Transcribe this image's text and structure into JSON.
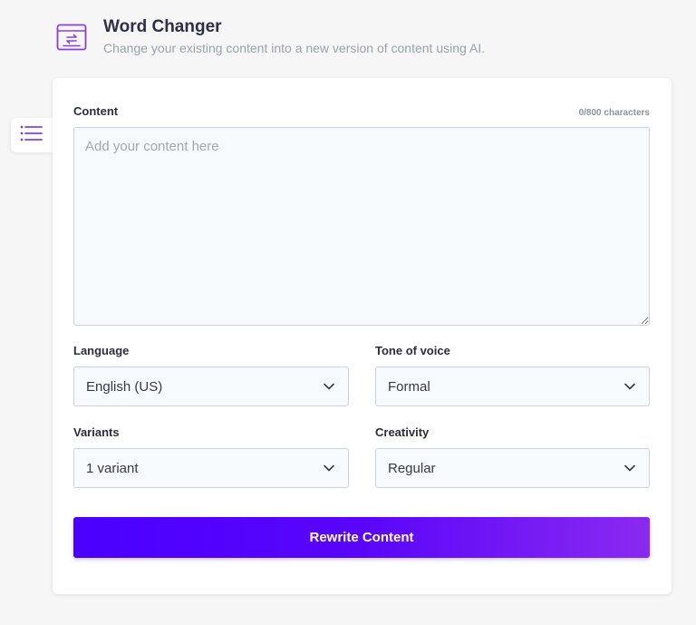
{
  "header": {
    "title": "Word Changer",
    "subtitle": "Change your existing content into a new version of content using AI.",
    "icon": "text-replace-icon"
  },
  "sidebar_toggle": {
    "icon": "list-icon"
  },
  "form": {
    "content": {
      "label": "Content",
      "counter": "0/800 characters",
      "placeholder": "Add your content here",
      "value": ""
    },
    "language": {
      "label": "Language",
      "value": "English (US)"
    },
    "tone": {
      "label": "Tone of voice",
      "value": "Formal"
    },
    "variants": {
      "label": "Variants",
      "value": "1 variant"
    },
    "creativity": {
      "label": "Creativity",
      "value": "Regular"
    },
    "submit_label": "Rewrite Content"
  },
  "colors": {
    "accent": "#5b0cf5",
    "gradient_start": "#4a00ff",
    "gradient_end": "#8a2af0",
    "icon_purple": "#8b3fd9"
  }
}
